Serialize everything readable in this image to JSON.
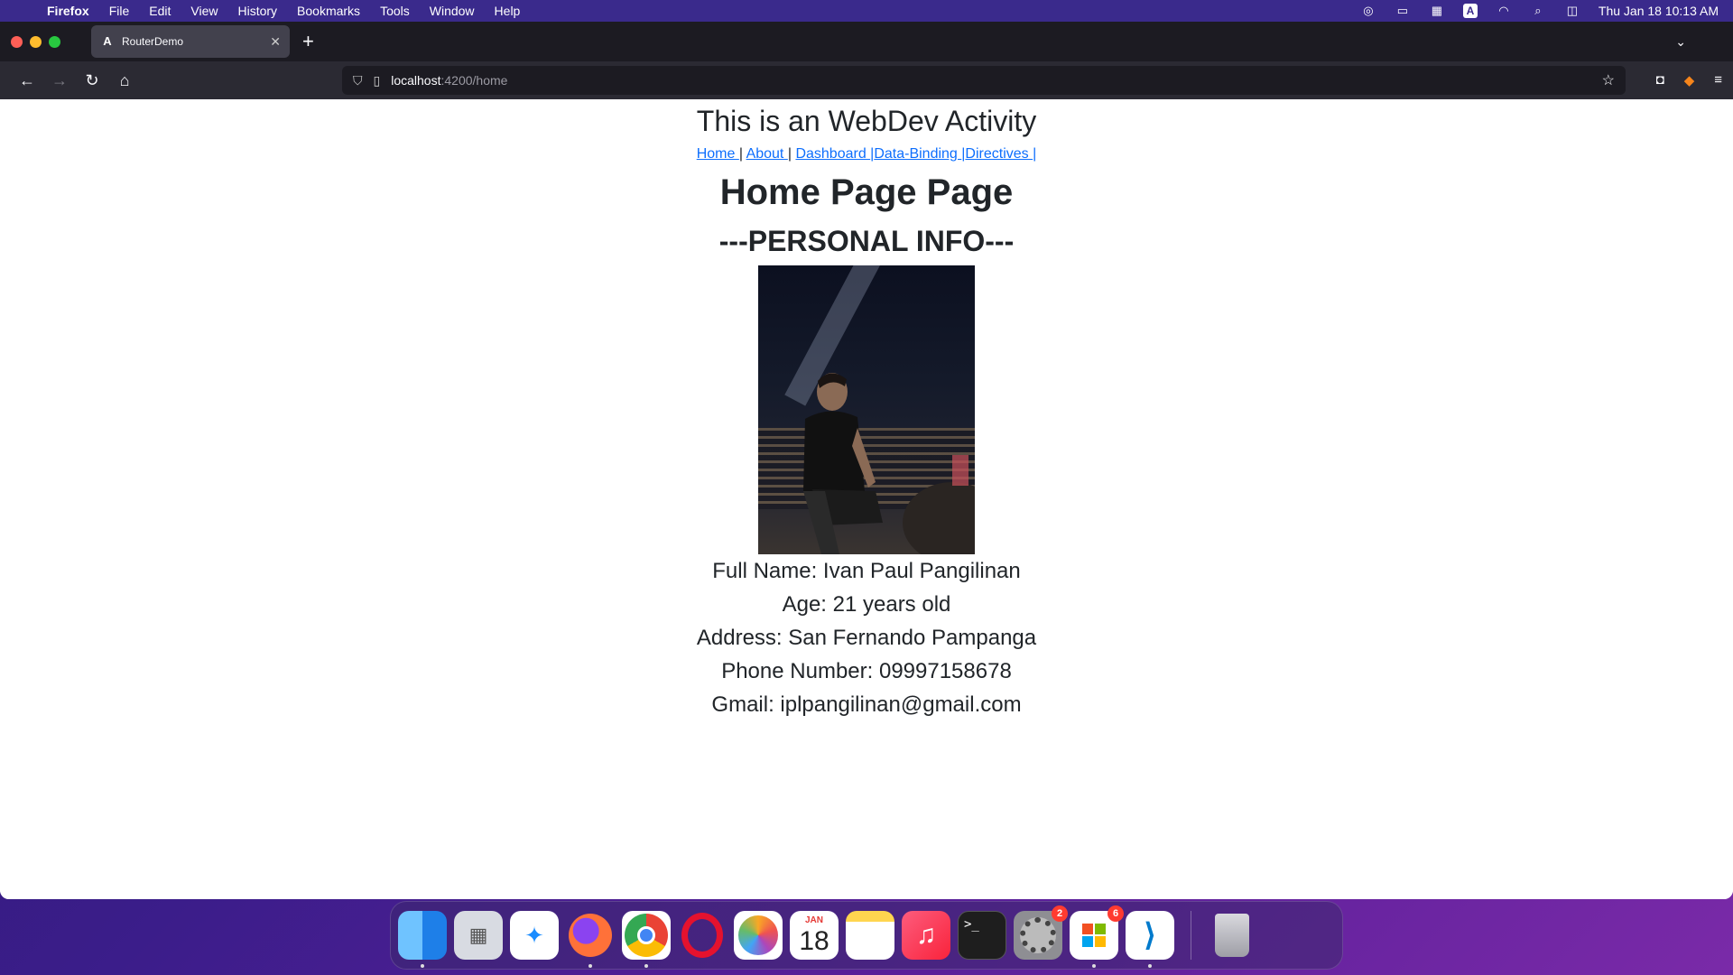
{
  "menubar": {
    "apple_icon": "apple-logo-icon",
    "app_name": "Firefox",
    "items": [
      "File",
      "Edit",
      "View",
      "History",
      "Bookmarks",
      "Tools",
      "Window",
      "Help"
    ],
    "clock": "Thu Jan 18  10:13 AM",
    "input_source": "A"
  },
  "browser": {
    "tab": {
      "favicon": "A",
      "title": "RouterDemo"
    },
    "url": {
      "host": "localhost",
      "path": ":4200/home"
    }
  },
  "page": {
    "site_title": "This is an WebDev Activity",
    "nav": {
      "home": "Home ",
      "about": "About ",
      "dashboard": "Dashboard ",
      "data_binding": "Data-Binding ",
      "directives": "Directives ",
      "separator": "|"
    },
    "page_heading": "Home Page Page",
    "section_heading": "---PERSONAL INFO---",
    "info": {
      "full_name": "Full Name: Ivan Paul Pangilinan",
      "age": "Age: 21 years old",
      "address": "Address: San Fernando Pampanga",
      "phone": "Phone Number: 09997158678",
      "gmail": "Gmail: iplpangilinan@gmail.com"
    }
  },
  "dock": {
    "calendar_month": "JAN",
    "calendar_day": "18",
    "settings_badge": "2",
    "store_badge": "6",
    "terminal_prompt": ">_"
  },
  "colors": {
    "link": "#0d6efd",
    "text": "#212529",
    "menubar": "#3a2a8c"
  }
}
